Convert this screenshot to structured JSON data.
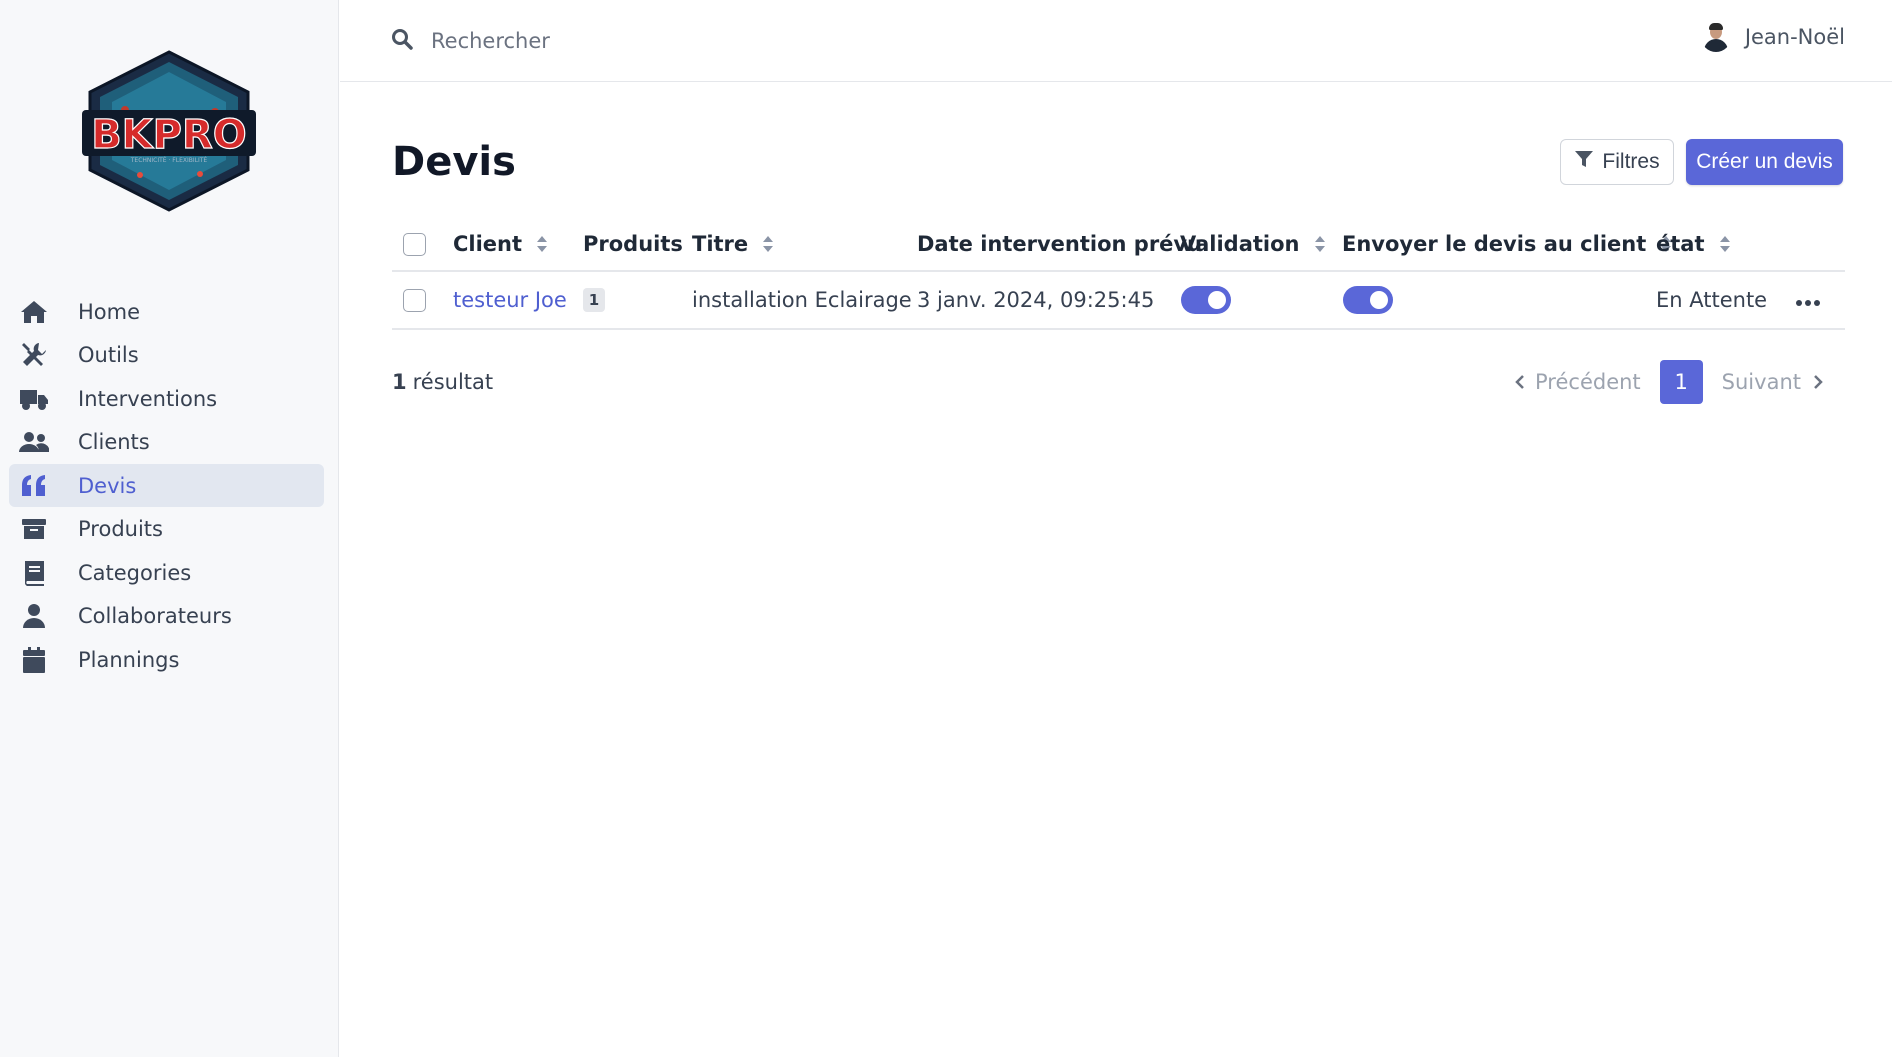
{
  "sidebar": {
    "logo_text": "BKPRO",
    "logo_tagline": "TECHNICITÉ · FLEXIBILITÉ",
    "items": [
      {
        "label": "Home",
        "icon": "home-icon"
      },
      {
        "label": "Outils",
        "icon": "tools-icon"
      },
      {
        "label": "Interventions",
        "icon": "truck-icon"
      },
      {
        "label": "Clients",
        "icon": "users-icon"
      },
      {
        "label": "Devis",
        "icon": "quote-icon",
        "active": true
      },
      {
        "label": "Produits",
        "icon": "archive-icon"
      },
      {
        "label": "Categories",
        "icon": "book-icon"
      },
      {
        "label": "Collaborateurs",
        "icon": "user-icon"
      },
      {
        "label": "Plannings",
        "icon": "calendar-icon"
      }
    ]
  },
  "topbar": {
    "search_placeholder": "Rechercher",
    "user_name": "Jean-Noël"
  },
  "page": {
    "title": "Devis",
    "filter_label": "Filtres",
    "create_label": "Créer un devis"
  },
  "table": {
    "columns": {
      "client": "Client",
      "produits": "Produits",
      "titre": "Titre",
      "date": "Date intervention prévu",
      "validation": "Validation",
      "envoyer": "Envoyer le devis au client",
      "etat": "état"
    },
    "rows": [
      {
        "client": "testeur Joe",
        "produits": "1",
        "titre": "installation Eclairage",
        "date": "3 janv. 2024, 09:25:45",
        "validation": true,
        "envoyer": true,
        "etat": "En Attente"
      }
    ]
  },
  "footer": {
    "count": "1",
    "result_label": "résultat",
    "prev_label": "Précédent",
    "page": "1",
    "next_label": "Suivant"
  },
  "colors": {
    "accent": "#5a67d8",
    "active_nav_bg": "#e2e7f0",
    "sidebar_bg": "#f7f8fa"
  }
}
